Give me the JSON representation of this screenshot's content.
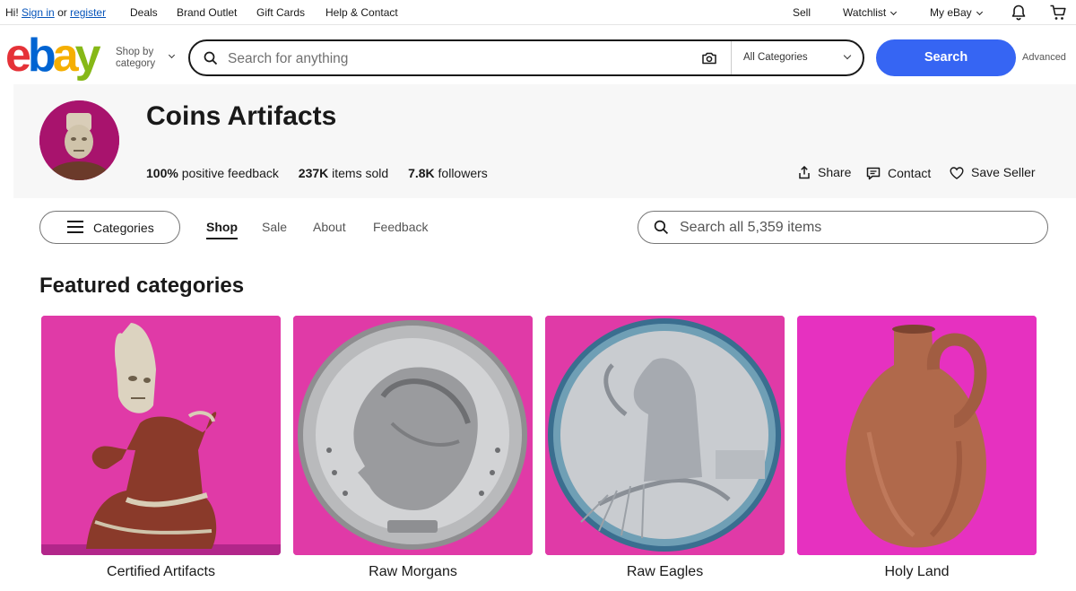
{
  "topbar": {
    "greeting": "Hi!",
    "sign_in": "Sign in",
    "or": "or",
    "register": "register",
    "links": [
      "Deals",
      "Brand Outlet",
      "Gift Cards",
      "Help & Contact"
    ],
    "sell": "Sell",
    "watchlist": "Watchlist",
    "my_ebay": "My eBay"
  },
  "header": {
    "logo_letters": [
      "e",
      "b",
      "a",
      "y"
    ],
    "shop_by_line1": "Shop by",
    "shop_by_line2": "category",
    "search_placeholder": "Search for anything",
    "category_select": "All Categories",
    "search_button": "Search",
    "advanced": "Advanced"
  },
  "seller": {
    "name": "Coins Artifacts",
    "feedback_value": "100%",
    "feedback_label": "positive feedback",
    "sold_value": "237K",
    "sold_label": "items sold",
    "followers_value": "7.8K",
    "followers_label": "followers",
    "share": "Share",
    "contact": "Contact",
    "save_seller": "Save Seller"
  },
  "store_nav": {
    "categories_button": "Categories",
    "tabs": [
      "Shop",
      "Sale",
      "About",
      "Feedback"
    ],
    "active_tab": "Shop",
    "search_placeholder": "Search all 5,359 items"
  },
  "featured": {
    "title": "Featured categories",
    "cards": [
      {
        "label": "Certified Artifacts",
        "image": "clay-figure"
      },
      {
        "label": "Raw Morgans",
        "image": "morgan-dollar"
      },
      {
        "label": "Raw Eagles",
        "image": "silver-eagle"
      },
      {
        "label": "Holy Land",
        "image": "clay-jug"
      }
    ]
  },
  "colors": {
    "search_button": "#3665f3",
    "link": "#0654ba",
    "image_background": "#e62eb8",
    "logo_e": "#e53238",
    "logo_b": "#0064d2",
    "logo_a": "#f5af02",
    "logo_y": "#86b817"
  }
}
